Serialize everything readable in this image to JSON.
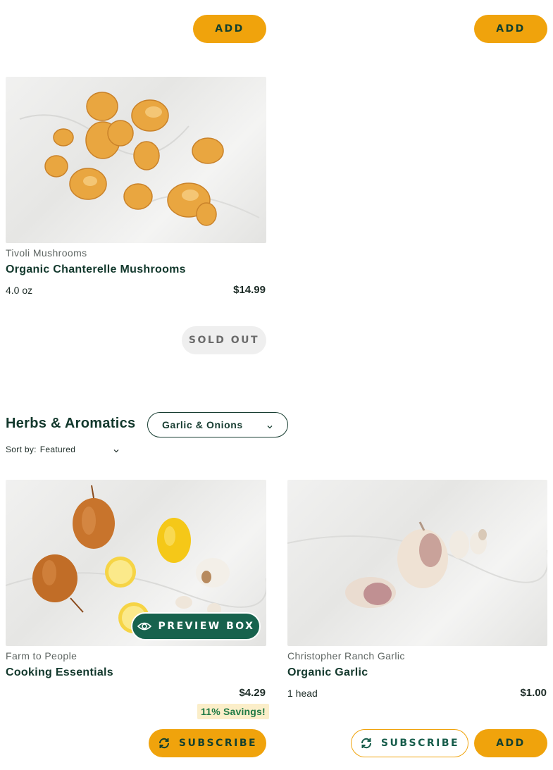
{
  "top_buttons": {
    "left_label": "ADD",
    "right_label": "ADD"
  },
  "chanterelle": {
    "brand": "Tivoli Mushrooms",
    "name": "Organic Chanterelle Mushrooms",
    "unit": "4.0 oz",
    "price": "$14.99",
    "button_label": "SOLD OUT"
  },
  "section": {
    "title": "Herbs & Aromatics",
    "category_selected": "Garlic & Onions",
    "sort_label": "Sort by:",
    "sort_value": "Featured"
  },
  "products": [
    {
      "brand": "Farm to People",
      "name": "Cooking Essentials",
      "price": "$4.29",
      "savings": "11% Savings!",
      "preview_label": "PREVIEW BOX",
      "subscribe_label": "SUBSCRIBE"
    },
    {
      "brand": "Christopher Ranch Garlic",
      "name": "Organic Garlic",
      "unit": "1 head",
      "price": "$1.00",
      "subscribe_label": "SUBSCRIBE",
      "add_label": "ADD"
    }
  ],
  "icons": {
    "subscribe": "refresh-icon",
    "preview": "eye-icon",
    "dropdown": "chevron-down-icon"
  },
  "colors": {
    "accent_yellow": "#f0a30c",
    "brand_green": "#17624d",
    "dark_green": "#12382c",
    "savings_bg": "#fbeec9",
    "savings_text": "#1f7a45",
    "sold_out_bg": "#efefef"
  }
}
